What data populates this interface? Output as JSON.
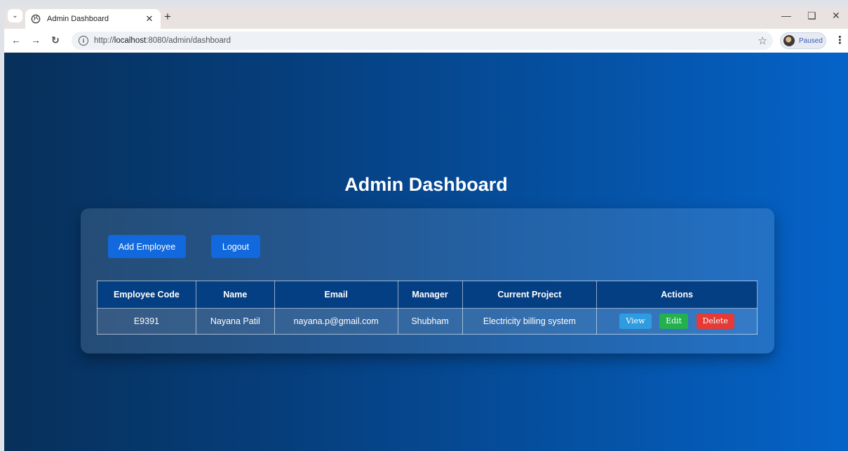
{
  "browser": {
    "tab_title": "Admin Dashboard",
    "new_tab_symbol": "+",
    "url_prefix": "http://",
    "url_host": "localhost",
    "url_rest": ":8080/admin/dashboard",
    "profile_status": "Paused"
  },
  "page": {
    "heading": "Admin Dashboard",
    "add_employee_label": "Add Employee",
    "logout_label": "Logout"
  },
  "table": {
    "columns": [
      "Employee Code",
      "Name",
      "Email",
      "Manager",
      "Current Project",
      "Actions"
    ],
    "rows": [
      {
        "code": "E9391",
        "name": "Nayana Patil",
        "email": "nayana.p@gmail.com",
        "manager": "Shubham",
        "project": "Electricity billing system",
        "actions": {
          "view": "View",
          "edit": "Edit",
          "delete": "Delete"
        }
      }
    ]
  },
  "colors": {
    "primary_button": "#1169dd",
    "table_header": "#053f83",
    "view_button": "#2f9ce0",
    "edit_button": "#23b14d",
    "delete_button": "#e53a35"
  }
}
